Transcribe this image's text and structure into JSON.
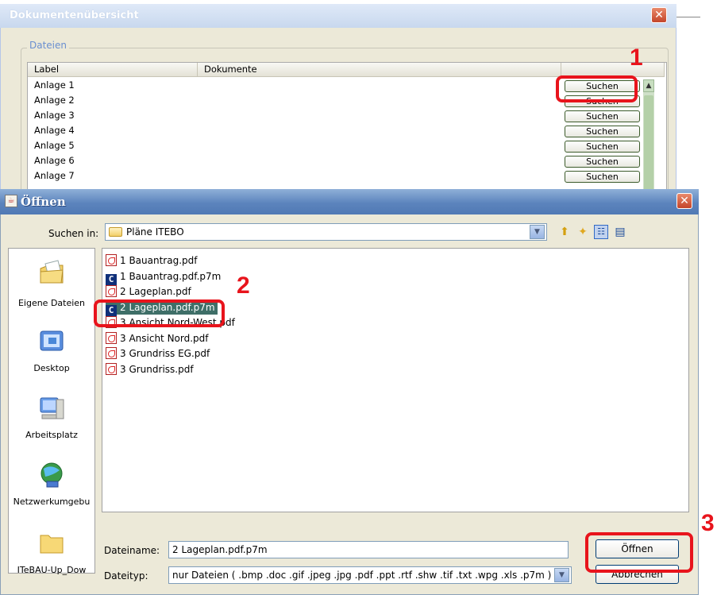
{
  "background_window": {
    "title": "Dokumentenübersicht",
    "close_glyph": "✕",
    "group_label": "Dateien",
    "columns": [
      "Label",
      "Dokumente"
    ],
    "rows": [
      {
        "label": "Anlage 1",
        "button": "Suchen"
      },
      {
        "label": "Anlage 2",
        "button": "Suchen"
      },
      {
        "label": "Anlage 3",
        "button": "Suchen"
      },
      {
        "label": "Anlage 4",
        "button": "Suchen"
      },
      {
        "label": "Anlage 5",
        "button": "Suchen"
      },
      {
        "label": "Anlage 6",
        "button": "Suchen"
      },
      {
        "label": "Anlage 7",
        "button": "Suchen"
      }
    ]
  },
  "dialog": {
    "title": "Öffnen",
    "close_glyph": "✕",
    "look_in_label": "Suchen in:",
    "look_in_value": "Pläne ITEBO",
    "sidebar": [
      {
        "label": "Eigene Dateien",
        "icon": "my-documents-icon"
      },
      {
        "label": "Desktop",
        "icon": "desktop-icon"
      },
      {
        "label": "Arbeitsplatz",
        "icon": "my-computer-icon"
      },
      {
        "label": "Netzwerkumgebu",
        "icon": "network-icon"
      },
      {
        "label": "ITeBAU-Up_Dow",
        "icon": "folder-icon"
      }
    ],
    "files": [
      {
        "name": "1 Bauantrag.pdf",
        "type": "pdf",
        "selected": false
      },
      {
        "name": "1 Bauantrag.pdf.p7m",
        "type": "p7m",
        "selected": false
      },
      {
        "name": "2 Lageplan.pdf",
        "type": "pdf",
        "selected": false
      },
      {
        "name": "2 Lageplan.pdf.p7m",
        "type": "p7m",
        "selected": true
      },
      {
        "name": "3 Ansicht Nord-West.pdf",
        "type": "pdf",
        "selected": false
      },
      {
        "name": "3 Ansicht Nord.pdf",
        "type": "pdf",
        "selected": false
      },
      {
        "name": "3 Grundriss EG.pdf",
        "type": "pdf",
        "selected": false
      },
      {
        "name": "3 Grundriss.pdf",
        "type": "pdf",
        "selected": false
      }
    ],
    "filename_label": "Dateiname:",
    "filename_value": "2 Lageplan.pdf.p7m",
    "filetype_label": "Dateityp:",
    "filetype_value": "nur Dateien ( .bmp .doc .gif .jpeg .jpg .pdf .ppt .rtf .shw .tif .txt .wpg .xls .p7m )",
    "open_button": "Öffnen",
    "cancel_button": "Abbrechen"
  },
  "annotations": [
    "1",
    "2",
    "3"
  ],
  "colors": {
    "annotation_red": "#e8141c",
    "selection": "#3f6f68",
    "title_blue": "#5c84bd"
  }
}
